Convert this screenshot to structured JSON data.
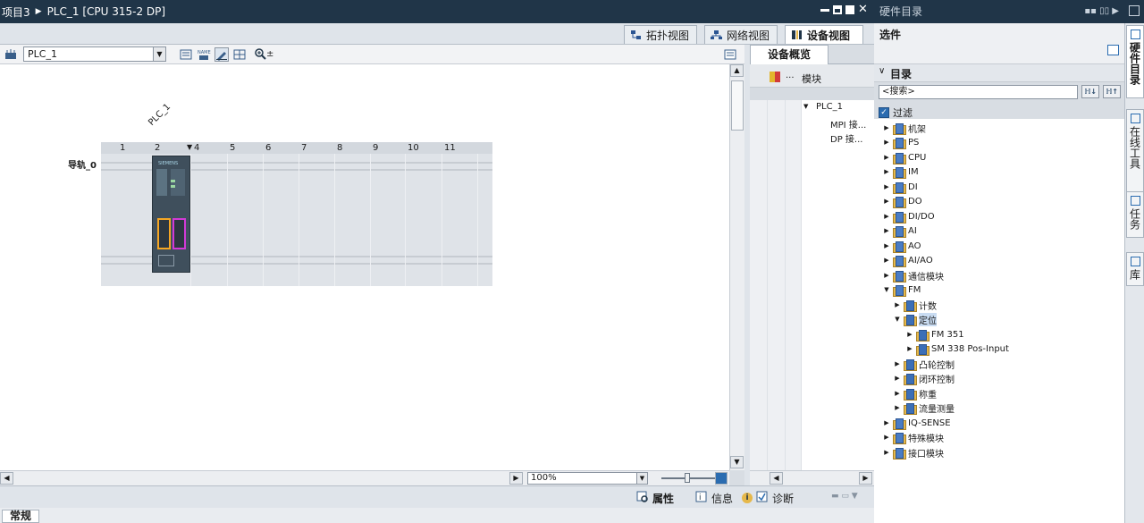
{
  "titlebar": {
    "project": "项目3",
    "device": "PLC_1 [CPU 315-2 DP]"
  },
  "view_tabs": [
    {
      "label": "拓扑视图",
      "icon": "topology-view-icon"
    },
    {
      "label": "网络视图",
      "icon": "network-view-icon"
    },
    {
      "label": "设备视图",
      "icon": "device-view-icon",
      "active": true
    }
  ],
  "toolbar": {
    "device_selected": "PLC_1"
  },
  "canvas": {
    "plc_label": "PLC_1",
    "rail_label": "导轨_0",
    "slots": [
      "1",
      "2",
      "4",
      "5",
      "6",
      "7",
      "8",
      "9",
      "10",
      "11"
    ],
    "cpu_brand": "SIEMENS"
  },
  "zoom": {
    "value": "100%"
  },
  "overview": {
    "tab_label": "设备概览",
    "col_dots": "...",
    "col_module": "模块",
    "rows": [
      {
        "label": "PLC_1",
        "expanded": true
      },
      {
        "label": "MPI 接..."
      },
      {
        "label": "DP 接..."
      }
    ]
  },
  "inspector": {
    "tabs": [
      {
        "label": "属性",
        "icon": "properties-icon",
        "active": true
      },
      {
        "label": "信息",
        "icon": "info-icon"
      },
      {
        "label": "诊断",
        "icon": "diagnostics-icon"
      }
    ],
    "general_tab": "常规"
  },
  "hardware_catalog": {
    "title": "硬件目录",
    "options_label": "选件",
    "catalog_label": "目录",
    "search_placeholder": "<搜索>",
    "filter_label": "过滤",
    "filter_checked": true,
    "tree": [
      {
        "label": "机架",
        "level": 0
      },
      {
        "label": "PS",
        "level": 0
      },
      {
        "label": "CPU",
        "level": 0
      },
      {
        "label": "IM",
        "level": 0
      },
      {
        "label": "DI",
        "level": 0
      },
      {
        "label": "DO",
        "level": 0
      },
      {
        "label": "DI/DO",
        "level": 0
      },
      {
        "label": "AI",
        "level": 0
      },
      {
        "label": "AO",
        "level": 0
      },
      {
        "label": "AI/AO",
        "level": 0
      },
      {
        "label": "通信模块",
        "level": 0
      },
      {
        "label": "FM",
        "level": 0,
        "expanded": true
      },
      {
        "label": "计数",
        "level": 1
      },
      {
        "label": "定位",
        "level": 1,
        "expanded": true,
        "selected": true
      },
      {
        "label": "FM 351",
        "level": 2
      },
      {
        "label": "SM 338 Pos-Input",
        "level": 2
      },
      {
        "label": "凸轮控制",
        "level": 1
      },
      {
        "label": "闭环控制",
        "level": 1
      },
      {
        "label": "称重",
        "level": 1
      },
      {
        "label": "流量测量",
        "level": 1
      },
      {
        "label": "IQ-SENSE",
        "level": 0
      },
      {
        "label": "特殊模块",
        "level": 0
      },
      {
        "label": "接口模块",
        "level": 0
      }
    ]
  },
  "side_tabs": [
    {
      "label": "硬件目录",
      "active": true
    },
    {
      "label": "在线工具"
    },
    {
      "label": "任务"
    },
    {
      "label": "库"
    }
  ]
}
